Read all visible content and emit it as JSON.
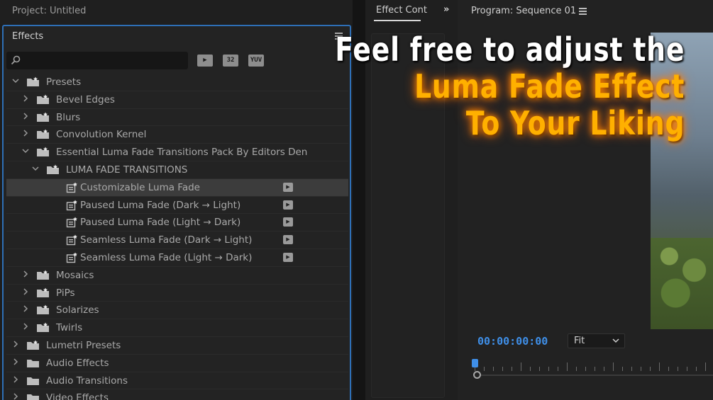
{
  "project": {
    "title": "Project: Untitled"
  },
  "effects_panel": {
    "title": "Effects",
    "search": {
      "value": "",
      "placeholder": ""
    },
    "filters": [
      "accelerated-effects",
      "32",
      "YUV"
    ],
    "tree": [
      {
        "label": "Presets",
        "expanded": true,
        "type": "folder"
      },
      {
        "label": "Bevel Edges",
        "type": "folder"
      },
      {
        "label": "Blurs",
        "type": "folder"
      },
      {
        "label": "Convolution Kernel",
        "type": "folder"
      },
      {
        "label": "Essential Luma Fade Transitions Pack By Editors Den",
        "expanded": true,
        "type": "folder"
      },
      {
        "label": "LUMA FADE TRANSITIONS",
        "expanded": true,
        "type": "folder"
      },
      {
        "label": "Customizable Luma Fade",
        "type": "preset",
        "selected": true
      },
      {
        "label": "Paused Luma Fade (Dark → Light)",
        "type": "preset"
      },
      {
        "label": "Paused Luma Fade (Light → Dark)",
        "type": "preset"
      },
      {
        "label": "Seamless Luma Fade (Dark → Light)",
        "type": "preset"
      },
      {
        "label": "Seamless Luma Fade (Light → Dark)",
        "type": "preset"
      },
      {
        "label": "Mosaics",
        "type": "folder"
      },
      {
        "label": "PiPs",
        "type": "folder"
      },
      {
        "label": "Solarizes",
        "type": "folder"
      },
      {
        "label": "Twirls",
        "type": "folder"
      },
      {
        "label": "Lumetri Presets",
        "type": "folder"
      },
      {
        "label": "Audio Effects",
        "type": "folder"
      },
      {
        "label": "Audio Transitions",
        "type": "folder"
      },
      {
        "label": "Video Effects",
        "type": "folder"
      }
    ]
  },
  "effect_controls": {
    "tab": "Effect Cont",
    "more": "»"
  },
  "program_monitor": {
    "title": "Program: Sequence 01",
    "timecode": "00:00:00:00",
    "zoom": "Fit"
  },
  "overlay": {
    "line1": "Feel free to adjust the",
    "line2": "Luma Fade Effect",
    "line3": "To Your Liking"
  },
  "colors": {
    "accent": "#3f8fe8",
    "panel_focus": "#2e6fb6",
    "headline_orange": "#ffb000"
  }
}
